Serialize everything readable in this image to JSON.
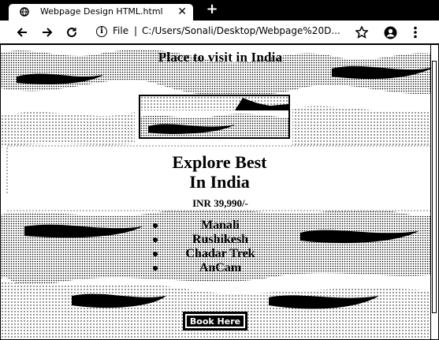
{
  "browser": {
    "tab": {
      "title": "Webpage Design HTML.html",
      "close_icon": "close-icon",
      "favicon": "globe-icon"
    },
    "new_tab_label": "+",
    "omnibox": {
      "label": "File",
      "separator": "|",
      "url": "C:/Users/Sonali/Desktop/Webpage%20D..."
    },
    "icons": [
      "back-arrow-icon",
      "forward-arrow-icon",
      "reload-icon",
      "info-icon",
      "star-icon",
      "account-icon",
      "menu-dots-icon"
    ]
  },
  "page": {
    "title": "Place to visit in India",
    "explore_heading_line1": "Explore Best",
    "explore_heading_line2": "In India",
    "price": "INR 39,990/-",
    "places": [
      "Manali",
      "Rushikesh",
      "Chadar Trek",
      "AnCam"
    ],
    "book_button": "Book Here"
  },
  "colors": {
    "chrome": "#000000",
    "page_bg": "#ffffff",
    "text": "#000000"
  }
}
